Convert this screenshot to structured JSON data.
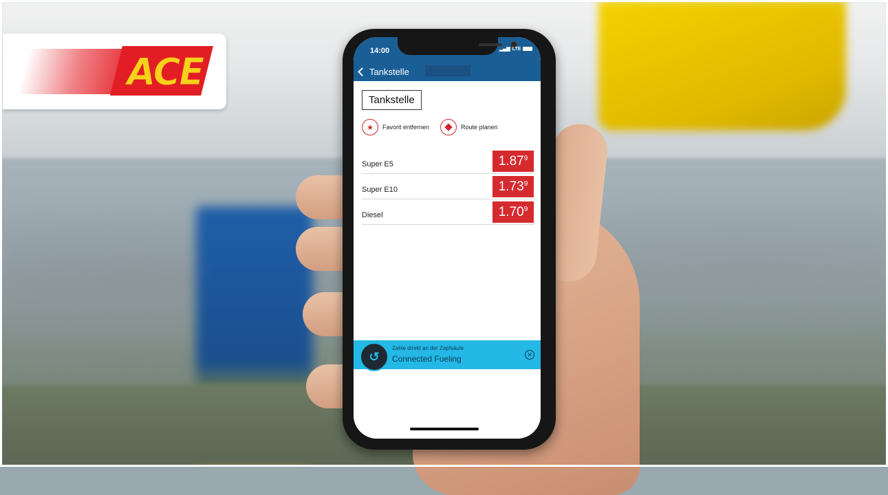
{
  "brand": {
    "logo_text": "ACE",
    "primary_color": "#e31d25",
    "logo_yellow": "#f7d11a"
  },
  "status_bar": {
    "time": "14:00",
    "network": "LTE"
  },
  "nav": {
    "back_label": "Tankstelle",
    "header_color": "#1a5e96"
  },
  "station": {
    "title": "Tankstelle"
  },
  "actions": [
    {
      "label": "Favorit entfernen",
      "icon": "star-icon"
    },
    {
      "label": "Route planen",
      "icon": "route-icon"
    }
  ],
  "prices": [
    {
      "fuel": "Super E5",
      "price": "1.87",
      "tenth": "9"
    },
    {
      "fuel": "Super E10",
      "price": "1.73",
      "tenth": "9"
    },
    {
      "fuel": "Diesel",
      "price": "1.70",
      "tenth": "9"
    }
  ],
  "price_color": "#d52a2e",
  "banner": {
    "line1": "Zahle direkt an der Zapfsäule",
    "line2": "Connected Fueling",
    "color": "#23b8e6"
  }
}
